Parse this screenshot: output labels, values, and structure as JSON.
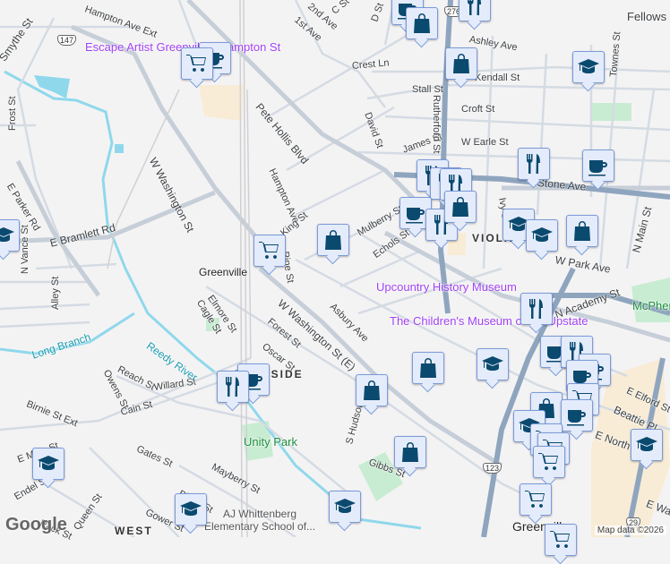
{
  "map": {
    "streets": [
      "Hampton Ave Ext",
      "Smythe St",
      "Pete Hollis Blvd",
      "W Washington St",
      "E Parker Rd",
      "Frost St",
      "E Bramlett Rd",
      "Hampton Ave",
      "King St",
      "Pine St",
      "Mulberry St",
      "Echols St",
      "Asbury Ave",
      "Forest St",
      "Oscar St",
      "Elmore St",
      "Cagle St",
      "Alley St",
      "N Vance St",
      "Reach St",
      "Owens St",
      "Willard St",
      "Birnie St Ext",
      "Cain St",
      "E Main St",
      "Gates St",
      "Mayberry St",
      "Birnie St",
      "Gower St",
      "Queen St",
      "Endel St",
      "Pack St",
      "S Hudson St",
      "Gibbs St",
      "1st Ave",
      "2nd Ave",
      "C St",
      "D St",
      "Ashley Ave",
      "Crest Ln",
      "Kendall St",
      "Stall St",
      "Croft St",
      "David St",
      "James St",
      "W Earle St",
      "Rutherford St",
      "Stone Ave",
      "Ivy St",
      "Townes St",
      "W Park Ave",
      "N Academy St",
      "E Elford St",
      "Beattie Pl",
      "E North St",
      "E Washington St",
      "N Main St",
      "W Washington St (E)"
    ],
    "places": {
      "escape": "Escape Artist Greenville - Hampton St",
      "upcountry": "Upcountry History Museum",
      "childrens": "The Children's Museum of the Upstate",
      "whittenberg": "AJ Whittenberg Elementary School of...",
      "fellowship": "Fellows",
      "station": "Greenville",
      "unity": "Unity Park"
    },
    "areas": [
      "VIOLA",
      "WEST",
      "FERNSIDE",
      "Greenville",
      "McPherson Park"
    ],
    "water": [
      "Reedy River",
      "Long Branch"
    ],
    "shields": [
      "147",
      "276",
      "123",
      "29"
    ],
    "attribution": "Map data ©2026",
    "logo": "Google",
    "markers": [
      "cup",
      "cart",
      "cup",
      "bag",
      "food",
      "bag",
      "edu",
      "food",
      "food",
      "food",
      "food",
      "cup",
      "cup",
      "food",
      "bag",
      "edu",
      "edu",
      "bag",
      "bag",
      "cart",
      "edu",
      "food",
      "cup",
      "food",
      "cup",
      "cup",
      "cart",
      "bag",
      "cup",
      "edu",
      "cart",
      "cart",
      "cart",
      "edu",
      "cart",
      "cart",
      "bag",
      "edu",
      "bag",
      "bag",
      "cup",
      "food",
      "edu",
      "edu",
      "edu"
    ]
  },
  "colors": {
    "marker_icon": "#0b4a6f",
    "marker_bg": "#e4ecfb",
    "poi": "#a142f4",
    "highway": "#8fa5be"
  }
}
